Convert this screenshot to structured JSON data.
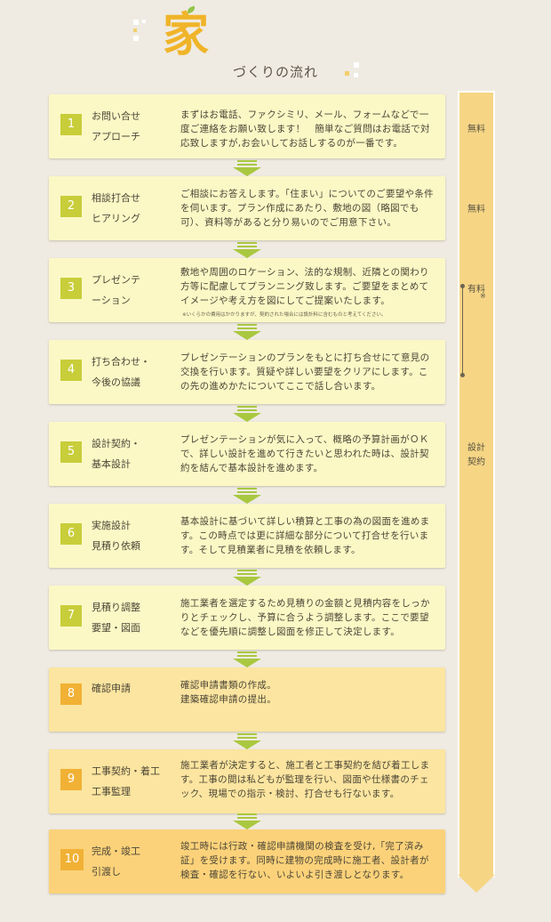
{
  "header": {
    "title_kanji": "家",
    "title_rest": "づくりの流れ"
  },
  "steps": [
    {
      "num": "1",
      "name1": "お問い合せ",
      "name2": "アプローチ",
      "desc": "まずはお電話、ファクシミリ、メール、フォームなどで一度ご連絡をお願い致します！　簡単なご質問はお電話で対応致しますが,お会いしてお話しするのが一番です。"
    },
    {
      "num": "2",
      "name1": "相談打合せ",
      "name2": "ヒアリング",
      "desc": "ご相談にお答えします。「住まい」についてのご要望や条件を伺います。プラン作成にあたり、敷地の図（略図でも可）、資料等があると分り易いのでご用意下さい。"
    },
    {
      "num": "3",
      "name1": "プレゼンテ",
      "name2": "ーション",
      "desc": "敷地や周囲のロケーション、法的な規制、近隣との関わり方等に配慮してプランニング致します。ご要望をまとめてイメージや考え方を図にしてご提案いたします。",
      "note": "※いくらかの費用はかかりますが、契約された場合には設計料に含むものと考えてください。"
    },
    {
      "num": "4",
      "name1": "打ち合わせ・",
      "name2": "今後の協議",
      "desc": "プレゼンテーションのプランをもとに打ち合せにて意見の交換を行います。質疑や詳しい要望をクリアにします。この先の進めかたについてここで話し合います。"
    },
    {
      "num": "5",
      "name1": "設計契約・",
      "name2": "基本設計",
      "desc": "プレゼンテーションが気に入って、概略の予算計画がＯＫで、詳しい設計を進めて行きたいと思われた時は、設計契約を結んで基本設計を進めます。"
    },
    {
      "num": "6",
      "name1": "実施設計",
      "name2": "見積り依頼",
      "desc": "基本設計に基づいて詳しい積算と工事の為の図面を進めます。この時点では更に詳細な部分について打合せを行います。そして見積業者に見積を依頼します。"
    },
    {
      "num": "7",
      "name1": "見積り調整",
      "name2": "要望・図面",
      "desc": "施工業者を選定するため見積りの金額と見積内容をしっかりとチェックし、予算に合うよう調整します。ここで要望などを優先順に調整し図面を修正して決定します。"
    },
    {
      "num": "8",
      "name1": "確認申請",
      "name2": "",
      "desc": "確認申請書類の作成。\n建築確認申請の提出。"
    },
    {
      "num": "9",
      "name1": "工事契約・着工",
      "name2": "工事監理",
      "desc": "施工業者が決定すると、施工者と工事契約を結び着工します。工事の間は私どもが監理を行い、図面や仕様書のチェック、現場での指示・検討、打合せも行ないます。"
    },
    {
      "num": "10",
      "name1": "完成・竣工",
      "name2": "引渡し",
      "desc": "竣工時には行政・確認申請機関の検査を受け,「完了済み証」を受けます。同時に建物の完成時に施工者、設計者が検査・確認を行ない、いよいよ引き渡しとなります。"
    }
  ],
  "fees": {
    "free1": "無料",
    "free2": "無料",
    "paid": "有料",
    "paid_mark": "※",
    "contract1": "設計",
    "contract2": "契約"
  },
  "colors": {
    "green_card": "#fbf8c6",
    "orange_card": "#fbe5a0",
    "accent_green": "#c8cd3a",
    "accent_orange": "#f1b135"
  }
}
